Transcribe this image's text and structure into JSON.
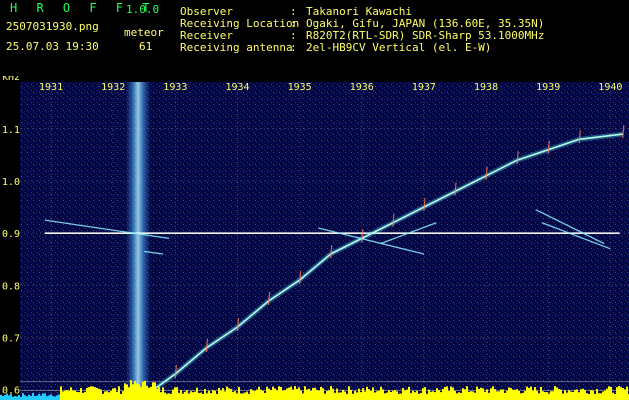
{
  "header": {
    "app_name": "H R O F F T",
    "version": "1.0.0",
    "file_name": "2507031930.png",
    "timestamp": "25.07.03 19:30",
    "meteor_label": "meteor",
    "meteor_count": "61",
    "info_labels": [
      "Observer",
      "Receiving Location",
      "Receiver",
      "Receiving antenna"
    ],
    "info_sep": ":",
    "info_values": [
      "Takanori Kawachi",
      "Ogaki, Gifu, JAPAN (136.60E, 35.35N)",
      "R820T2(RTL-SDR) SDR-Sharp 53.1000MHz",
      "2el-HB9CV Vertical (el. E-W)"
    ]
  },
  "colors": {
    "background": "#000000",
    "plot_bg": "#030640",
    "header_text": "#ffff66",
    "logo_text": "#22ff55",
    "axis_text": "#ffff66",
    "gridline": "#ffffff",
    "carrier_line": "#ffffff",
    "noise_floor": "#ffff00",
    "noise_low": "#22ccff",
    "meteor_band": "#6fd3ff"
  },
  "chart_data": {
    "type": "heatmap",
    "title": "",
    "xlabel": "",
    "ylabel": "kHz",
    "x_ticks": [
      "1931",
      "1932",
      "1933",
      "1934",
      "1935",
      "1936",
      "1937",
      "1938",
      "1939",
      "1940"
    ],
    "y_ticks": [
      "1.1",
      "1.0",
      "0.9",
      "0.8",
      "0.7",
      "0.6"
    ],
    "xlim": [
      1930.5,
      1940.3
    ],
    "ylim": [
      0.58,
      1.19
    ],
    "grid": true,
    "carrier_line_khz": 0.9,
    "meteor_band_minute": 1932.4,
    "doppler_trace": [
      {
        "t": 1932.65,
        "khz": 0.6
      },
      {
        "t": 1933.0,
        "khz": 0.63
      },
      {
        "t": 1933.5,
        "khz": 0.68
      },
      {
        "t": 1934.0,
        "khz": 0.72
      },
      {
        "t": 1934.5,
        "khz": 0.77
      },
      {
        "t": 1935.0,
        "khz": 0.81
      },
      {
        "t": 1935.5,
        "khz": 0.86
      },
      {
        "t": 1936.0,
        "khz": 0.89
      },
      {
        "t": 1936.5,
        "khz": 0.92
      },
      {
        "t": 1937.0,
        "khz": 0.95
      },
      {
        "t": 1937.5,
        "khz": 0.98
      },
      {
        "t": 1938.0,
        "khz": 1.01
      },
      {
        "t": 1938.5,
        "khz": 1.04
      },
      {
        "t": 1939.0,
        "khz": 1.06
      },
      {
        "t": 1939.5,
        "khz": 1.08
      },
      {
        "t": 1940.2,
        "khz": 1.09
      }
    ],
    "crossing_traces": [
      {
        "t0": 1930.9,
        "k0": 0.925,
        "t1": 1932.9,
        "k1": 0.89
      },
      {
        "t0": 1935.3,
        "k0": 0.91,
        "t1": 1937.0,
        "k1": 0.86
      },
      {
        "t0": 1936.3,
        "k0": 0.88,
        "t1": 1937.2,
        "k1": 0.92
      },
      {
        "t0": 1938.8,
        "k0": 0.945,
        "t1": 1939.9,
        "k1": 0.88
      },
      {
        "t0": 1938.9,
        "k0": 0.92,
        "t1": 1940.0,
        "k1": 0.87
      },
      {
        "t0": 1932.5,
        "k0": 0.865,
        "t1": 1932.8,
        "k1": 0.86
      }
    ]
  }
}
